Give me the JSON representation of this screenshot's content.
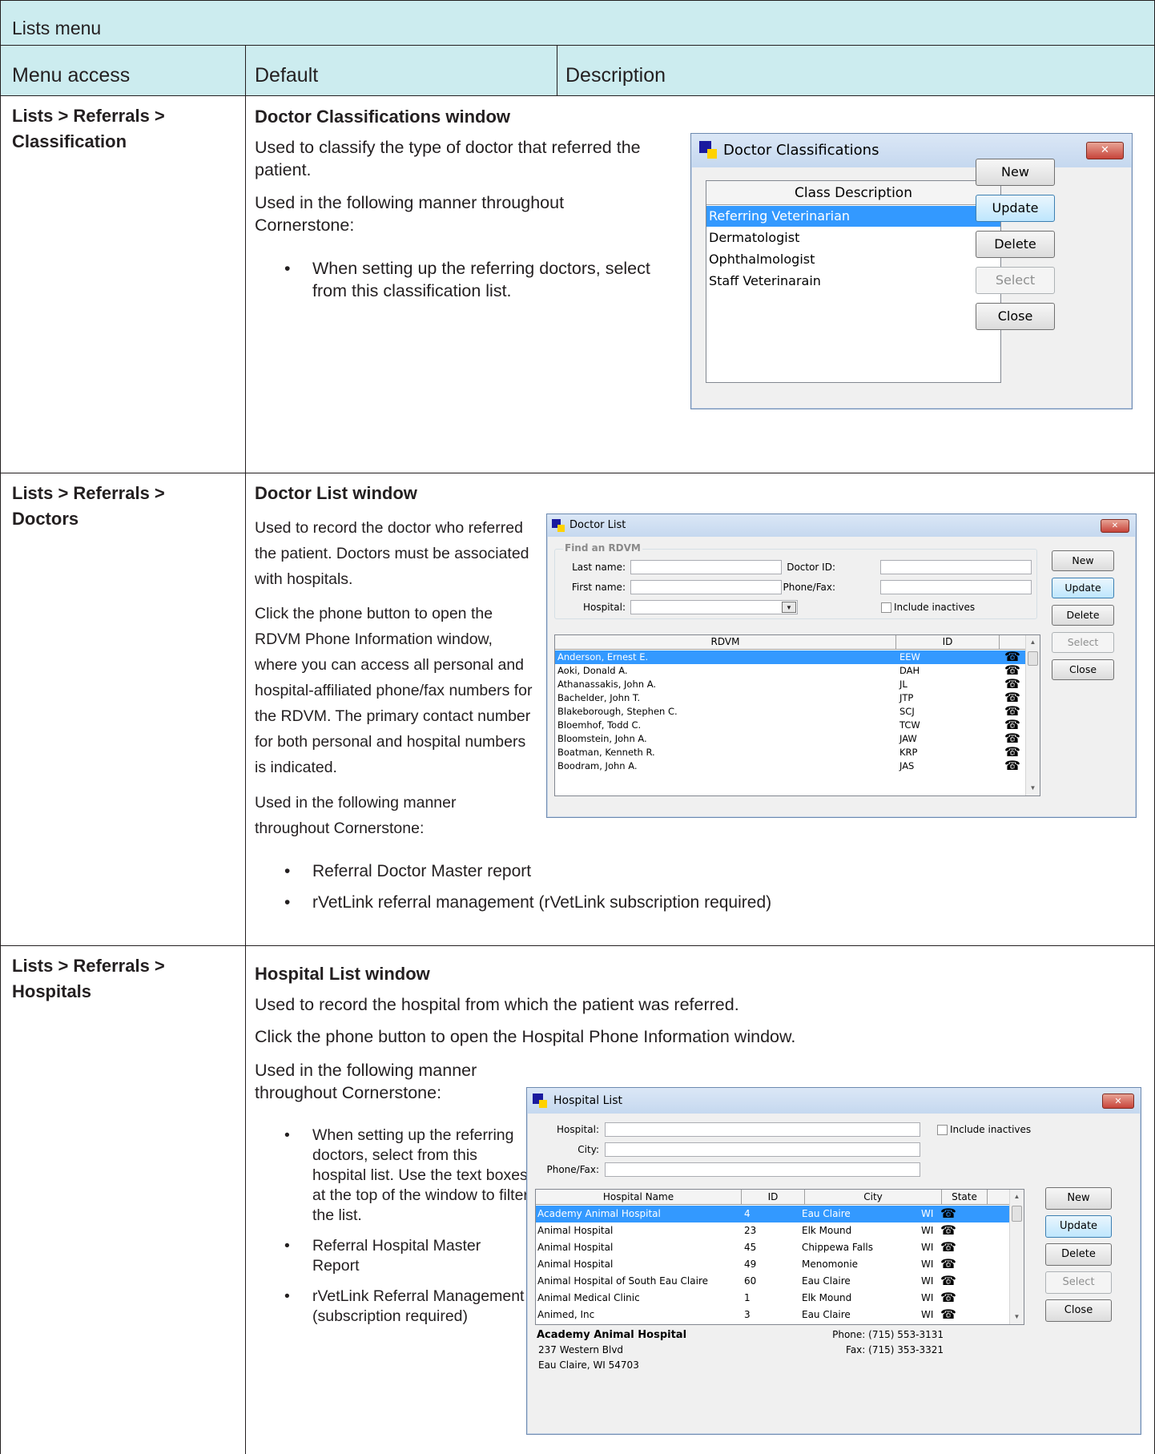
{
  "table": {
    "title": "Lists menu",
    "columns": [
      "Menu access",
      "Default",
      "Description"
    ]
  },
  "rows": [
    {
      "menu_line1": "Lists > Referrals >",
      "menu_line2": "Classification",
      "heading": "Doctor Classifications window",
      "para1": "Used to classify the type of doctor that referred the patient.",
      "para2": "Used in the following manner throughout Cornerstone:",
      "bullets": [
        "When setting up the referring doctors, select from this classification list."
      ],
      "window": {
        "title": "Doctor Classifications",
        "column_header": "Class Description",
        "items": [
          "Referring Veterinarian",
          "Dermatologist",
          "Ophthalmologist",
          "Staff Veterinarain"
        ],
        "selected_index": 0,
        "buttons": [
          "New",
          "Update",
          "Delete",
          "Select",
          "Close"
        ]
      }
    },
    {
      "menu_line1": "Lists > Referrals >",
      "menu_line2": "Doctors",
      "heading": "Doctor List window",
      "para1": "Used to record the doctor who referred the patient. Doctors must be associated with hospitals.",
      "para2": "Click the phone button to open the RDVM Phone Information window, where you can access all personal and hospital-affiliated phone/fax numbers for the RDVM. The primary contact number for both personal and hospital numbers is indicated.",
      "para3": "Used in the following manner throughout Cornerstone:",
      "bullets": [
        "Referral Doctor Master report",
        "rVetLink referral management (rVetLink subscription required)"
      ],
      "window": {
        "title": "Doctor List",
        "group_label": "Find an RDVM",
        "labels": {
          "last_name": "Last name:",
          "first_name": "First name:",
          "hospital": "Hospital:",
          "doctor_id": "Doctor ID:",
          "phone_fax": "Phone/Fax:",
          "include_inactives": "Include inactives"
        },
        "columns": [
          "RDVM",
          "ID"
        ],
        "items": [
          {
            "name": "Anderson, Ernest  E.",
            "id": "EEW"
          },
          {
            "name": "Aoki, Donald  A.",
            "id": "DAH"
          },
          {
            "name": "Athanassakis, John  A.",
            "id": "JL"
          },
          {
            "name": "Bachelder, John  T.",
            "id": "JTP"
          },
          {
            "name": "Blakeborough, Stephen  C.",
            "id": "SCJ"
          },
          {
            "name": "Bloemhof, Todd  C.",
            "id": "TCW"
          },
          {
            "name": "Bloomstein, John  A.",
            "id": "JAW"
          },
          {
            "name": "Boatman, Kenneth  R.",
            "id": "KRP"
          },
          {
            "name": "Boodram, John  A.",
            "id": "JAS"
          }
        ],
        "selected_index": 0,
        "buttons": [
          "New",
          "Update",
          "Delete",
          "Select",
          "Close"
        ]
      }
    },
    {
      "menu_line1": "Lists > Referrals >",
      "menu_line2": "Hospitals",
      "heading": "Hospital List window",
      "para1": "Used to record the hospital from which the patient was referred.",
      "para2": "Click the phone button to open the Hospital Phone Information window.",
      "para3": "Used in the following manner throughout Cornerstone:",
      "bullets": [
        "When setting up the referring doctors, select from this hospital list. Use the text boxes at the top of the window to filter the list.",
        "Referral Hospital Master Report",
        "rVetLink Referral Management (subscription required)"
      ],
      "window": {
        "title": "Hospital List",
        "labels": {
          "hospital": "Hospital:",
          "city": "City:",
          "phone_fax": "Phone/Fax:",
          "include_inactives": "Include inactives"
        },
        "columns": [
          "Hospital Name",
          "ID",
          "City",
          "State"
        ],
        "items": [
          {
            "name": "Academy Animal Hospital",
            "id": "4",
            "city": "Eau Claire",
            "state": "WI"
          },
          {
            "name": "Animal Hospital",
            "id": "23",
            "city": "Elk Mound",
            "state": "WI"
          },
          {
            "name": "Animal Hospital",
            "id": "45",
            "city": "Chippewa Falls",
            "state": "WI"
          },
          {
            "name": "Animal Hospital",
            "id": "49",
            "city": "Menomonie",
            "state": "WI"
          },
          {
            "name": "Animal Hospital of South Eau Claire",
            "id": "60",
            "city": "Eau Claire",
            "state": "WI"
          },
          {
            "name": "Animal Medical Clinic",
            "id": "1",
            "city": "Elk Mound",
            "state": "WI"
          },
          {
            "name": "Animed, Inc",
            "id": "3",
            "city": "Eau Claire",
            "state": "WI"
          }
        ],
        "selected_index": 0,
        "buttons": [
          "New",
          "Update",
          "Delete",
          "Select",
          "Close"
        ],
        "details": {
          "name": "Academy Animal Hospital",
          "address1": "237 Western Blvd",
          "address2": "Eau Claire, WI 54703",
          "phone": "Phone:  (715) 553-3131",
          "fax": "Fax:  (715) 353-3321"
        }
      }
    }
  ]
}
